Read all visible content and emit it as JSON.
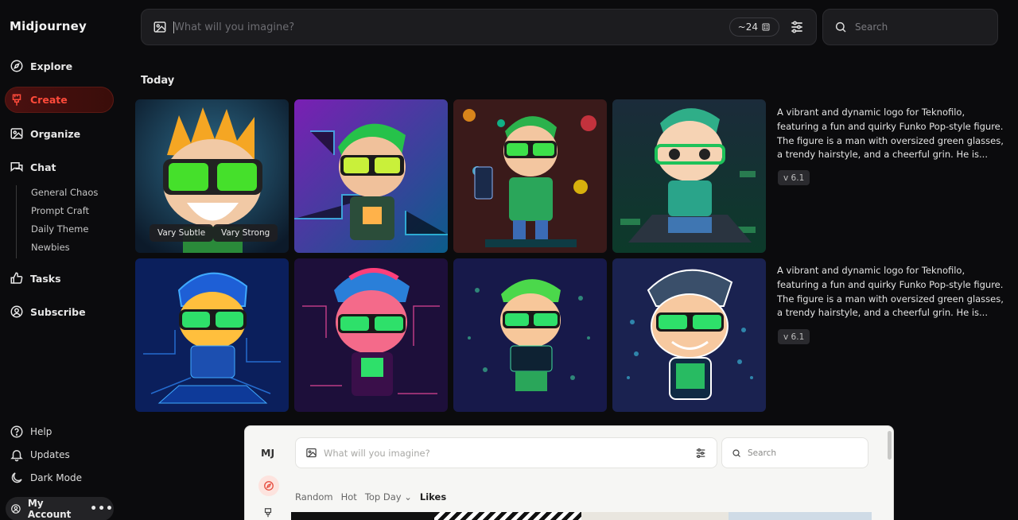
{
  "app": {
    "brand": "Midjourney"
  },
  "sidebar": {
    "items": [
      {
        "label": "Explore",
        "icon": "compass-icon"
      },
      {
        "label": "Create",
        "icon": "brush-icon",
        "active": true
      },
      {
        "label": "Organize",
        "icon": "image-icon"
      },
      {
        "label": "Chat",
        "icon": "chat-icon"
      }
    ],
    "chat_rooms": [
      "General Chaos",
      "Prompt Craft",
      "Daily Theme",
      "Newbies"
    ],
    "items2": [
      {
        "label": "Tasks",
        "icon": "thumbs-up-icon"
      },
      {
        "label": "Subscribe",
        "icon": "user-circle-icon"
      }
    ],
    "footer": [
      {
        "label": "Help",
        "icon": "help-icon"
      },
      {
        "label": "Updates",
        "icon": "bell-icon"
      },
      {
        "label": "Dark Mode",
        "icon": "moon-icon"
      }
    ],
    "account": {
      "label": "My Account",
      "more": "•••"
    }
  },
  "topbar": {
    "prompt_placeholder": "What will you imagine?",
    "count_pill": "~24",
    "search_placeholder": "Search"
  },
  "section": {
    "title": "Today"
  },
  "rows": [
    {
      "description": "A vibrant and dynamic logo for Teknofilo, featuring a fun and quirky Funko Pop-style figure. The figure is a man with oversized green glasses, a trendy hairstyle, and a cheerful grin. He is...",
      "version": "v 6.1",
      "hover_actions": [
        "Vary Subtle",
        "Vary Strong"
      ]
    },
    {
      "description": "A vibrant and dynamic logo for Teknofilo, featuring a fun and quirky Funko Pop-style figure. The figure is a man with oversized green glasses, a trendy hairstyle, and a cheerful grin. He is...",
      "version": "v 6.1"
    }
  ],
  "preview": {
    "logo": "MJ",
    "prompt_placeholder": "What will you imagine?",
    "search_placeholder": "Search",
    "tabs": [
      "Random",
      "Hot",
      "Top Day",
      "Likes"
    ],
    "tab_dropdown": "⌄"
  },
  "colors": {
    "accent": "#ff4a3a",
    "background": "#0b0b0d",
    "panel": "#1c1c1f"
  }
}
